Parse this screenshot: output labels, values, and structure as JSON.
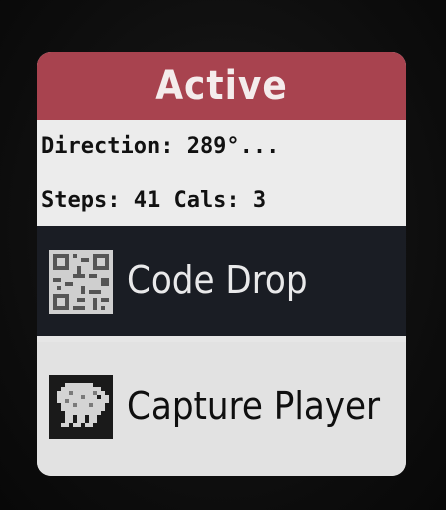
{
  "screen": {
    "title": "Active",
    "info": {
      "direction_line": "Direction: 289°...",
      "stats_line": "Steps: 41 Cals: 3"
    },
    "menu": [
      {
        "label": "Code Drop",
        "icon": "qr-code-icon",
        "selected": true
      },
      {
        "label": "Capture Player",
        "icon": "creature-icon",
        "selected": false
      }
    ]
  },
  "colors": {
    "header": "#a8434f",
    "selected_row": "#1a1d24",
    "row": "#e2e2e2"
  }
}
